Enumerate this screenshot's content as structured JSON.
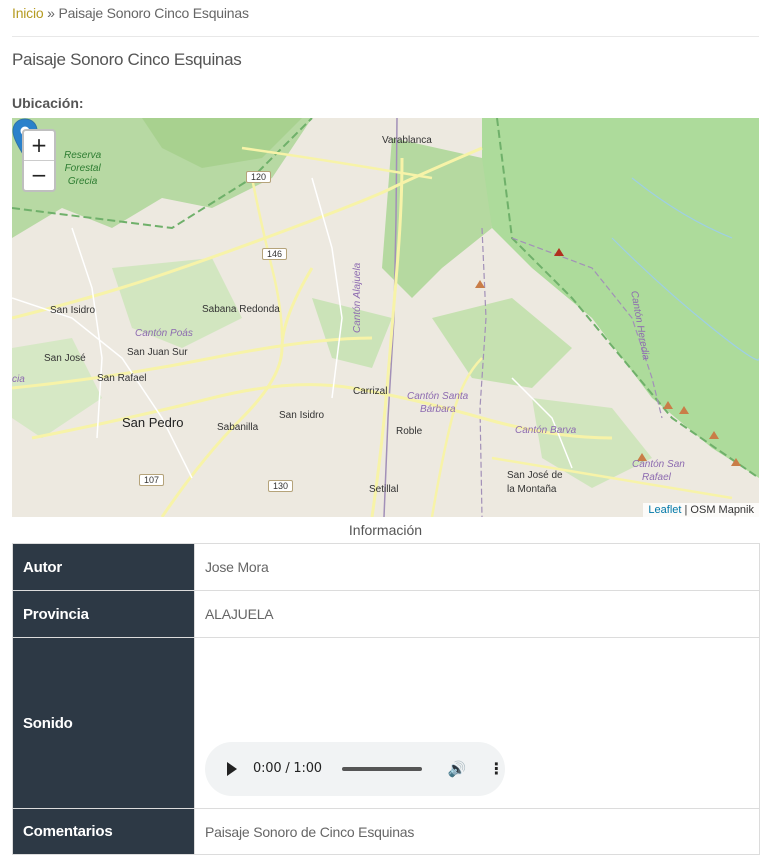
{
  "breadcrumb": {
    "home": "Inicio",
    "separator": " » ",
    "current": "Paisaje Sonoro Cinco Esquinas"
  },
  "page": {
    "title": "Paisaje Sonoro Cinco Esquinas",
    "location_label": "Ubicación:"
  },
  "map": {
    "zoom_in": "+",
    "zoom_out": "−",
    "attribution_link": "Leaflet",
    "attribution_sep": " | ",
    "attribution_text": "OSM Mapnik",
    "places": {
      "varablanca": "Varablanca",
      "san_isidro_w": "San Isidro",
      "sabana_redonda": "Sabana Redonda",
      "san_jose": "San José",
      "san_juan_sur": "San Juan Sur",
      "san_rafael": "San Rafael",
      "san_pedro": "San Pedro",
      "sabanilla": "Sabanilla",
      "san_isidro_s": "San Isidro",
      "carrizal": "Carrizal",
      "robie": "Roble",
      "setillal": "Setillal",
      "san_jose_montana_1": "San José de",
      "san_jose_montana_2": "la Montaña",
      "cia": "cia"
    },
    "regions": {
      "poas": "Cantón Poás",
      "santa_barbara_1": "Cantón Santa",
      "santa_barbara_2": "Bárbara",
      "barva": "Cantón Barva",
      "san_rafael_1": "Cantón San",
      "san_rafael_2": "Rafael",
      "alajuela": "Cantón Alajuela",
      "heredia": "Cantón Heredia"
    },
    "reserve": {
      "line1": "Reserva",
      "line2": "Forestal",
      "line3": "Grecia"
    },
    "shields": {
      "r120": "120",
      "r146": "146",
      "r107": "107",
      "r130": "130"
    }
  },
  "info": {
    "caption": "Información",
    "rows": {
      "autor": {
        "label": "Autor",
        "value": "Jose Mora"
      },
      "provincia": {
        "label": "Provincia",
        "value": "ALAJUELA"
      },
      "sonido": {
        "label": "Sonido"
      },
      "comentarios": {
        "label": "Comentarios",
        "value": "Paisaje Sonoro de Cinco Esquinas"
      }
    },
    "audio": {
      "time": "0:00 / 1:00"
    }
  }
}
